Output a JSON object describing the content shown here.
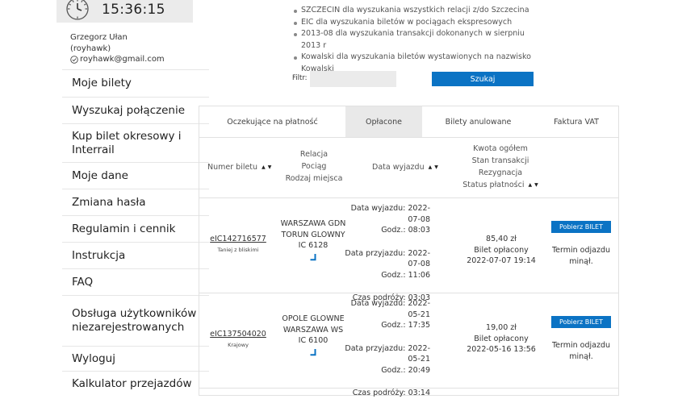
{
  "clock": {
    "time": "15:36:15"
  },
  "user": {
    "name": "Grzegorz Ułan",
    "login": "(royhawk)",
    "email": "royhawk@gmail.com"
  },
  "menu": [
    "Moje bilety",
    "Wyszukaj połączenie",
    "Kup bilet okresowy i Interrail",
    "Moje dane",
    "Zmiana hasła",
    "Regulamin i cennik",
    "Instrukcja",
    "FAQ",
    "Obsługa użytkowników niezarejestrowanych",
    "Wyloguj",
    "Kalkulator przejazdów"
  ],
  "hints": [
    "SZCZECIN dla wyszukania wszystkich relacji z/do Szczecina",
    "EIC dla wyszukania biletów w pociągach ekspresowych",
    "2013-08 dla wyszukania transakcji dokonanych w sierpniu 2013 r",
    "Kowalski dla wyszukania biletów wystawionych na nazwisko Kowalski"
  ],
  "filter": {
    "label": "Filtr:",
    "value": "",
    "button": "Szukaj"
  },
  "tabs": [
    "Oczekujące na płatność",
    "Opłacone",
    "Bilety anulowane",
    "Faktura VAT"
  ],
  "columns": {
    "ticket_number": "Numer biletu",
    "relation": "Relacja",
    "train": "Pociąg",
    "seat_type": "Rodzaj miejsca",
    "travel_date": "Data wyjazdu",
    "total": "Kwota ogółem",
    "transaction_state": "Stan transakcji",
    "resignation": "Rezygnacja",
    "payment_status": "Status płatności"
  },
  "tickets": [
    {
      "number": "eIC142716577",
      "type": "Taniej z bliskimi",
      "from": "WARSZAWA GDN",
      "to": "TORUN GLOWNY",
      "train": "IC 6128",
      "departure_date": "Data wyjazdu: 2022-07-08",
      "departure_time": "Godz.: 08:03",
      "arrival_date": "Data przyjazdu: 2022-07-08",
      "arrival_time": "Godz.: 11:06",
      "duration": "Czas podróży: 03:03",
      "amount": "85,40 zł",
      "state": "Bilet opłacony",
      "paid_at": "2022-07-07 19:14",
      "download": "Pobierz BILET",
      "status": "Termin odjazdu minął."
    },
    {
      "number": "eIC137504020",
      "type": "Krajowy",
      "from": "OPOLE GLOWNE",
      "to": "WARSZAWA WS",
      "train": "IC 6100",
      "departure_date": "Data wyjazdu: 2022-05-21",
      "departure_time": "Godz.: 17:35",
      "arrival_date": "Data przyjazdu: 2022-05-21",
      "arrival_time": "Godz.: 20:49",
      "duration": "Czas podróży: 03:14",
      "amount": "19,00 zł",
      "state": "Bilet opłacony",
      "paid_at": "2022-05-16 13:56",
      "download": "Pobierz BILET",
      "status": "Termin odjazdu minął."
    }
  ]
}
